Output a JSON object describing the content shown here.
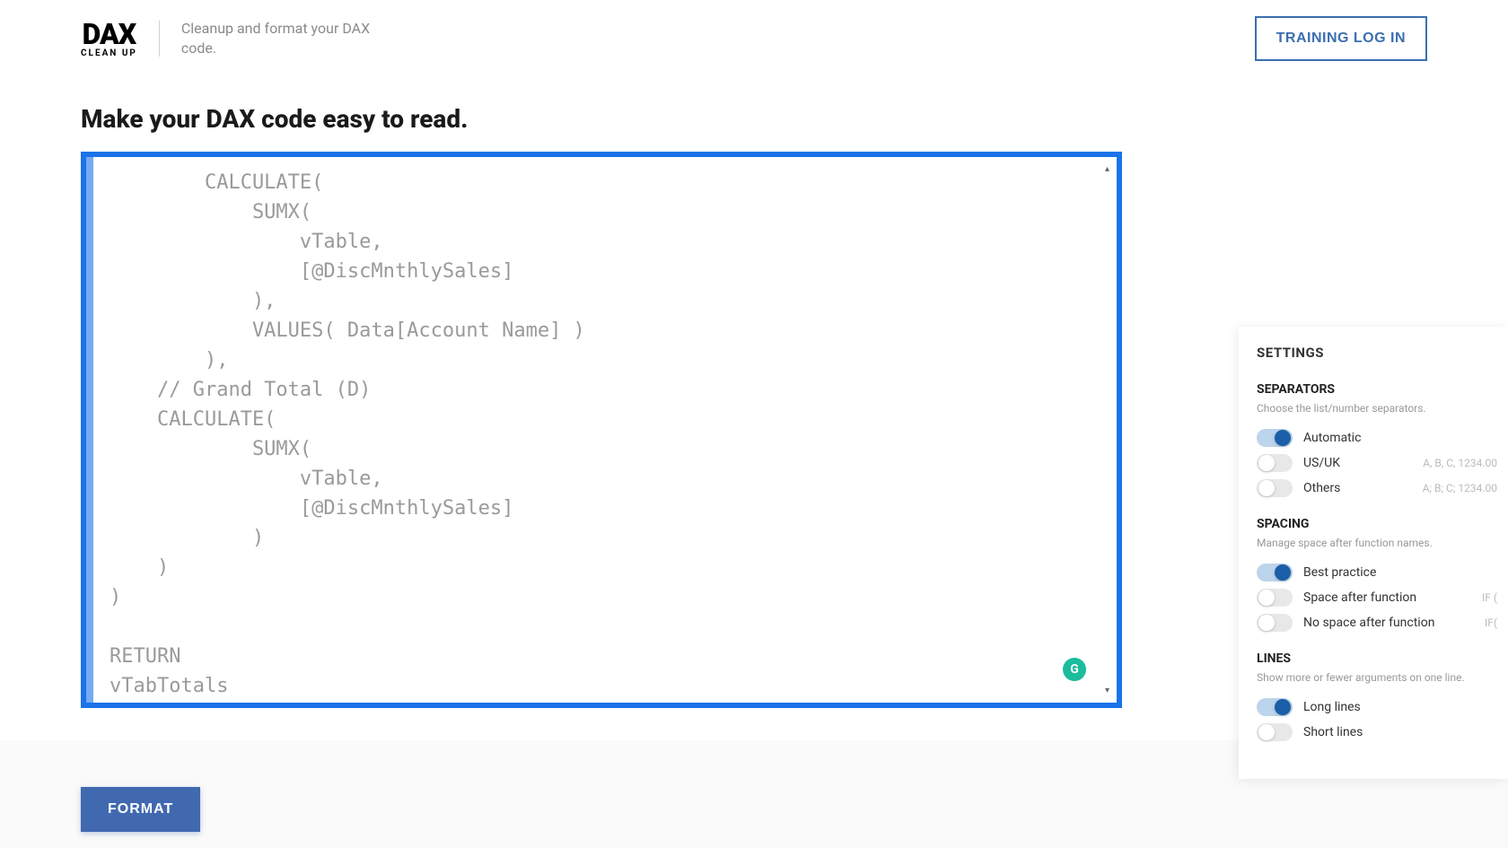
{
  "header": {
    "logo_main": "DAX",
    "logo_sub": "CLEAN UP",
    "tagline": "Cleanup and format your DAX code.",
    "training_button": "TRAINING LOG IN"
  },
  "page_title": "Make your DAX code easy to read.",
  "editor": {
    "code": "        CALCULATE(\n            SUMX(\n                vTable,\n                [@DiscMnthlySales]\n            ),\n            VALUES( Data[Account Name] )\n        ),\n    // Grand Total (D)\n    CALCULATE(\n            SUMX(\n                vTable,\n                [@DiscMnthlySales]\n            )\n    )\n)\n\nRETURN\nvTabTotals",
    "status_glyph": "G"
  },
  "settings": {
    "title": "SETTINGS",
    "separators": {
      "title": "SEPARATORS",
      "desc": "Choose the list/number separators.",
      "options": [
        {
          "label": "Automatic",
          "hint": "",
          "on": true
        },
        {
          "label": "US/UK",
          "hint": "A, B, C, 1234.00",
          "on": false
        },
        {
          "label": "Others",
          "hint": "A; B; C; 1234.00",
          "on": false
        }
      ]
    },
    "spacing": {
      "title": "SPACING",
      "desc": "Manage space after function names.",
      "options": [
        {
          "label": "Best practice",
          "hint": "",
          "on": true
        },
        {
          "label": "Space after function",
          "hint": "IF (",
          "on": false
        },
        {
          "label": "No space after function",
          "hint": "IF(",
          "on": false
        }
      ]
    },
    "lines": {
      "title": "LINES",
      "desc": "Show more or fewer arguments on one line.",
      "options": [
        {
          "label": "Long lines",
          "hint": "",
          "on": true
        },
        {
          "label": "Short lines",
          "hint": "",
          "on": false
        }
      ]
    }
  },
  "footer": {
    "format_button": "FORMAT"
  }
}
